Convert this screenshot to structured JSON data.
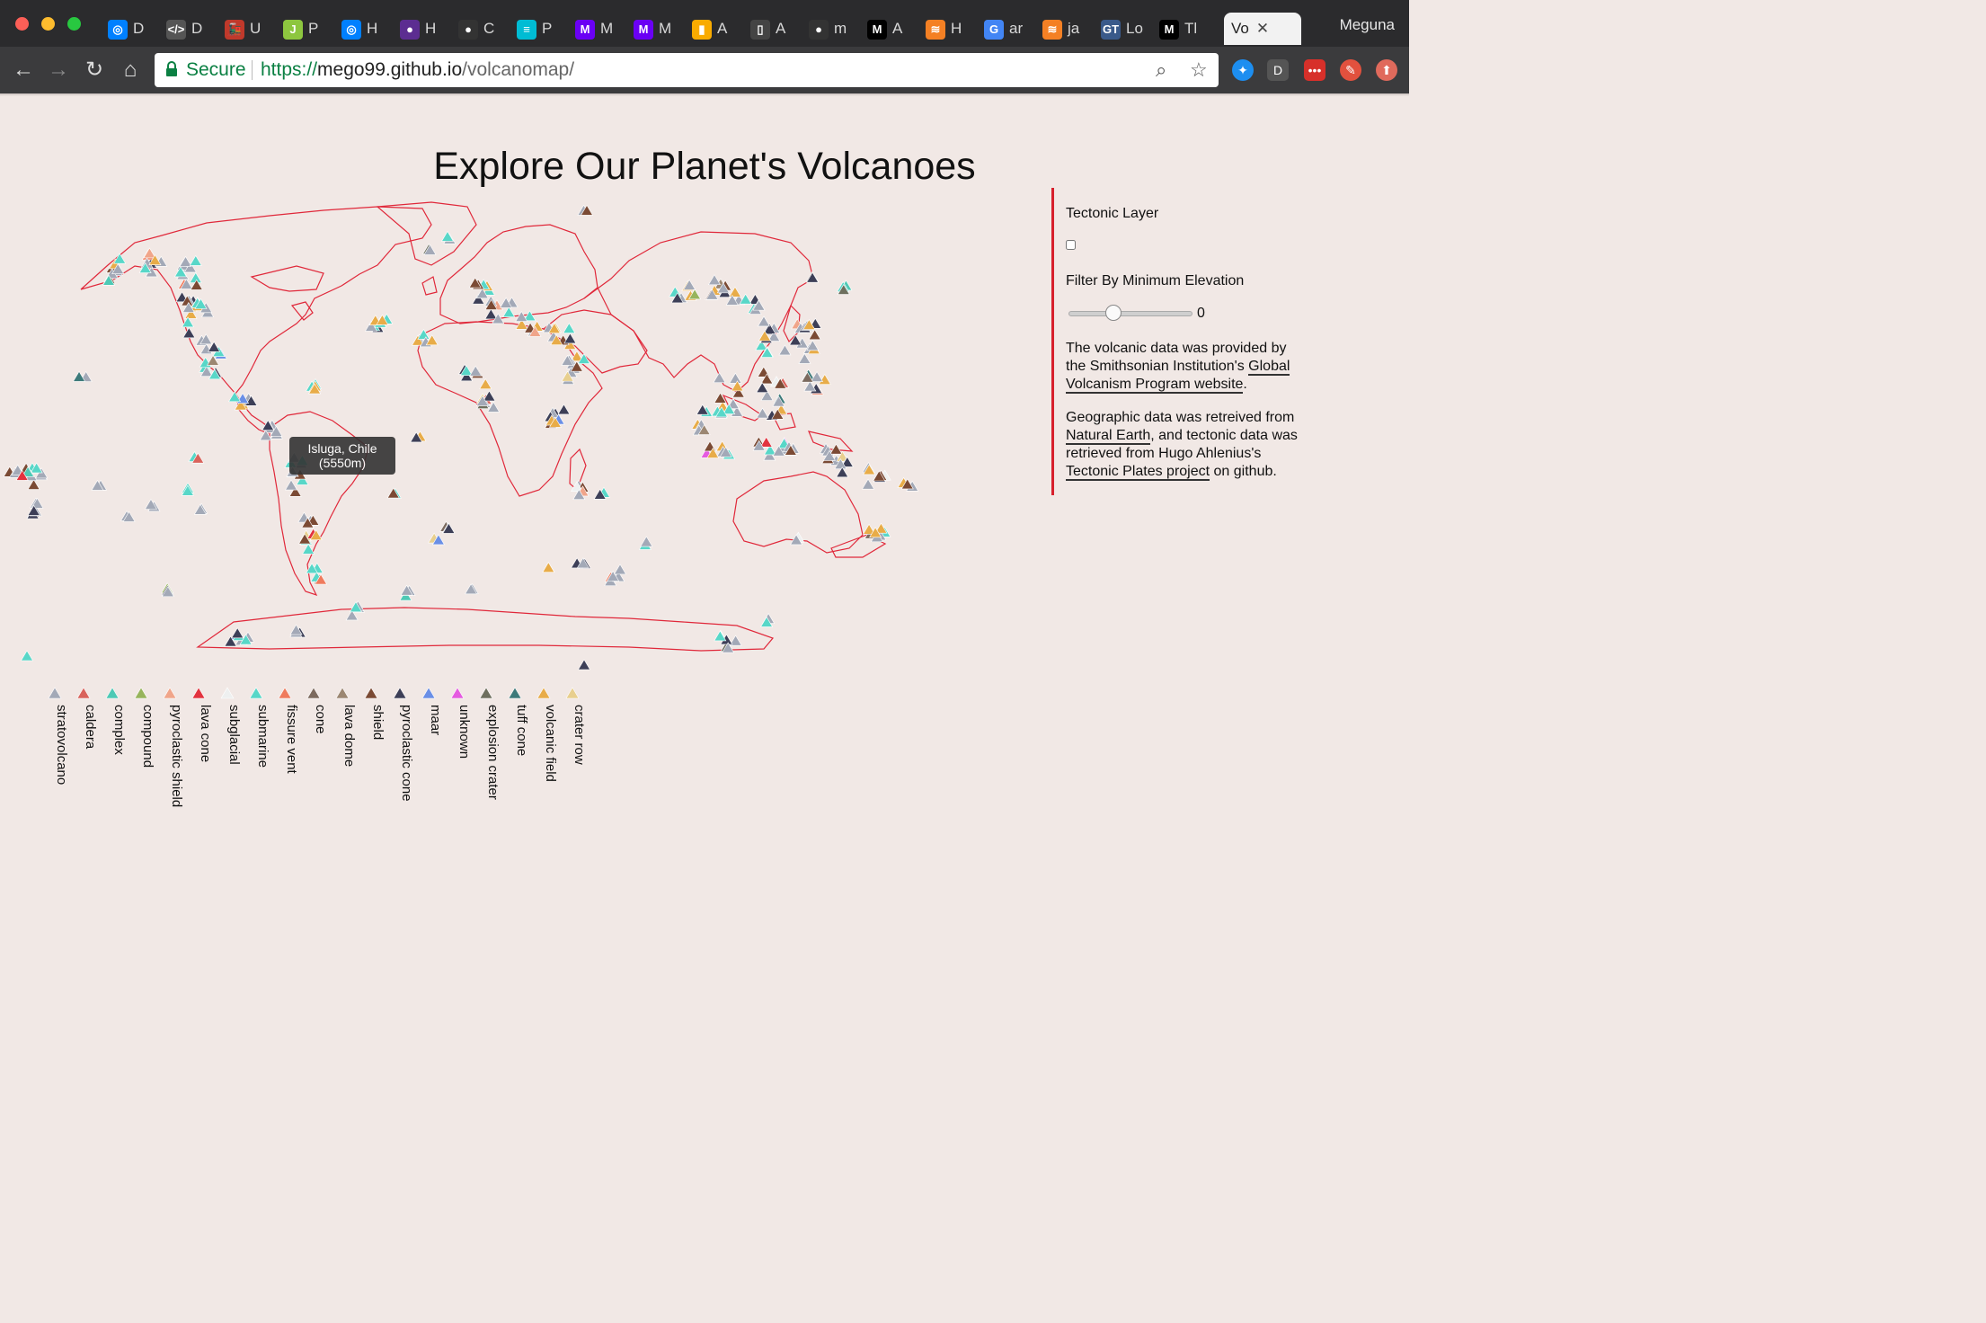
{
  "browser": {
    "tabs": [
      {
        "label": "D",
        "favicon": "digitalocean-icon",
        "color": "#0080ff",
        "glyph": "◎"
      },
      {
        "label": "D",
        "favicon": "doc-icon",
        "color": "#555",
        "glyph": "&lt;/&gt;"
      },
      {
        "label": "U",
        "favicon": "train-icon",
        "color": "#c0392b",
        "glyph": "🚂"
      },
      {
        "label": "P",
        "favicon": "j-icon",
        "color": "#8dc63f",
        "glyph": "J"
      },
      {
        "label": "H",
        "favicon": "digitalocean-icon",
        "color": "#0080ff",
        "glyph": "◎"
      },
      {
        "label": "H",
        "favicon": "circle-icon",
        "color": "#5c2d91",
        "glyph": "●"
      },
      {
        "label": "C",
        "favicon": "github-icon",
        "color": "#333",
        "glyph": "●"
      },
      {
        "label": "P",
        "favicon": "lines-icon",
        "color": "#00bcd4",
        "glyph": "≡"
      },
      {
        "label": "M",
        "favicon": "m-circle-icon",
        "color": "#6a00f4",
        "glyph": "M"
      },
      {
        "label": "M",
        "favicon": "m-circle-icon",
        "color": "#6a00f4",
        "glyph": "M"
      },
      {
        "label": "A",
        "favicon": "analytics-icon",
        "color": "#f9ab00",
        "glyph": "▮"
      },
      {
        "label": "A",
        "favicon": "document-icon",
        "color": "#444",
        "glyph": "▯"
      },
      {
        "label": "m",
        "favicon": "github-icon",
        "color": "#333",
        "glyph": "●"
      },
      {
        "label": "A",
        "favicon": "medium-icon",
        "color": "#000",
        "glyph": "M"
      },
      {
        "label": "H",
        "favicon": "stackoverflow-icon",
        "color": "#f48024",
        "glyph": "≋"
      },
      {
        "label": "ar",
        "favicon": "google-icon",
        "color": "#4285f4",
        "glyph": "G"
      },
      {
        "label": "ja",
        "favicon": "stackoverflow-icon",
        "color": "#f48024",
        "glyph": "≋"
      },
      {
        "label": "Lo",
        "favicon": "gt-icon",
        "color": "#3a5a8a",
        "glyph": "GT"
      },
      {
        "label": "Tl",
        "favicon": "medium-icon",
        "color": "#000",
        "glyph": "M"
      }
    ],
    "active_tab": "Vo",
    "profile_name": "Meguna",
    "secure_label": "Secure",
    "url_scheme": "https://",
    "url_host": "mego99.github.io",
    "url_path": "/volcanomap/"
  },
  "page": {
    "title": "Explore Our Planet's Volcanoes"
  },
  "sidebar": {
    "tectonic_label": "Tectonic Layer",
    "filter_label": "Filter By Minimum Elevation",
    "slider_value": "0",
    "slider_fraction": 0.36,
    "credit1_a": "The volcanic data was provided by",
    "credit1_b": "the Smithsonian Institution's",
    "credit1_link_a": "Global",
    "credit1_link_b": "Volcanism Program website",
    "credit1_end": ".",
    "credit2_a": "Geographic data was retreived from",
    "credit2_link1": "Natural Earth",
    "credit2_b": ", and tectonic data was",
    "credit2_c": "retrieved from Hugo Ahlenius's",
    "credit2_link2": "Tectonic Plates project",
    "credit2_d": " on github."
  },
  "tooltip": {
    "name": "Isluga, Chile",
    "elevation": "(5550m)"
  },
  "legend": [
    {
      "label": "stratovolcano",
      "color": "#a3a9b7"
    },
    {
      "label": "caldera",
      "color": "#d9635c"
    },
    {
      "label": "complex",
      "color": "#4ec9b5"
    },
    {
      "label": "compound",
      "color": "#97b45c"
    },
    {
      "label": "pyroclastic shield",
      "color": "#f0a58a"
    },
    {
      "label": "lava cone",
      "color": "#e2333f"
    },
    {
      "label": "subglacial",
      "color": "#eef0f0"
    },
    {
      "label": "submarine",
      "color": "#58d7c8"
    },
    {
      "label": "fissure vent",
      "color": "#ef7b5d"
    },
    {
      "label": "cone",
      "color": "#7c6a5e"
    },
    {
      "label": "lava dome",
      "color": "#9c8772"
    },
    {
      "label": "shield",
      "color": "#7b4a34"
    },
    {
      "label": "pyroclastic cone",
      "color": "#3d3f57"
    },
    {
      "label": "maar",
      "color": "#6a8fe6"
    },
    {
      "label": "unknown",
      "color": "#e55be0"
    },
    {
      "label": "explosion crater",
      "color": "#6e6f5e"
    },
    {
      "label": "tuff cone",
      "color": "#3d7a7a"
    },
    {
      "label": "volcanic field",
      "color": "#e8ac48"
    },
    {
      "label": "crater row",
      "color": "#e8cf8e"
    }
  ]
}
